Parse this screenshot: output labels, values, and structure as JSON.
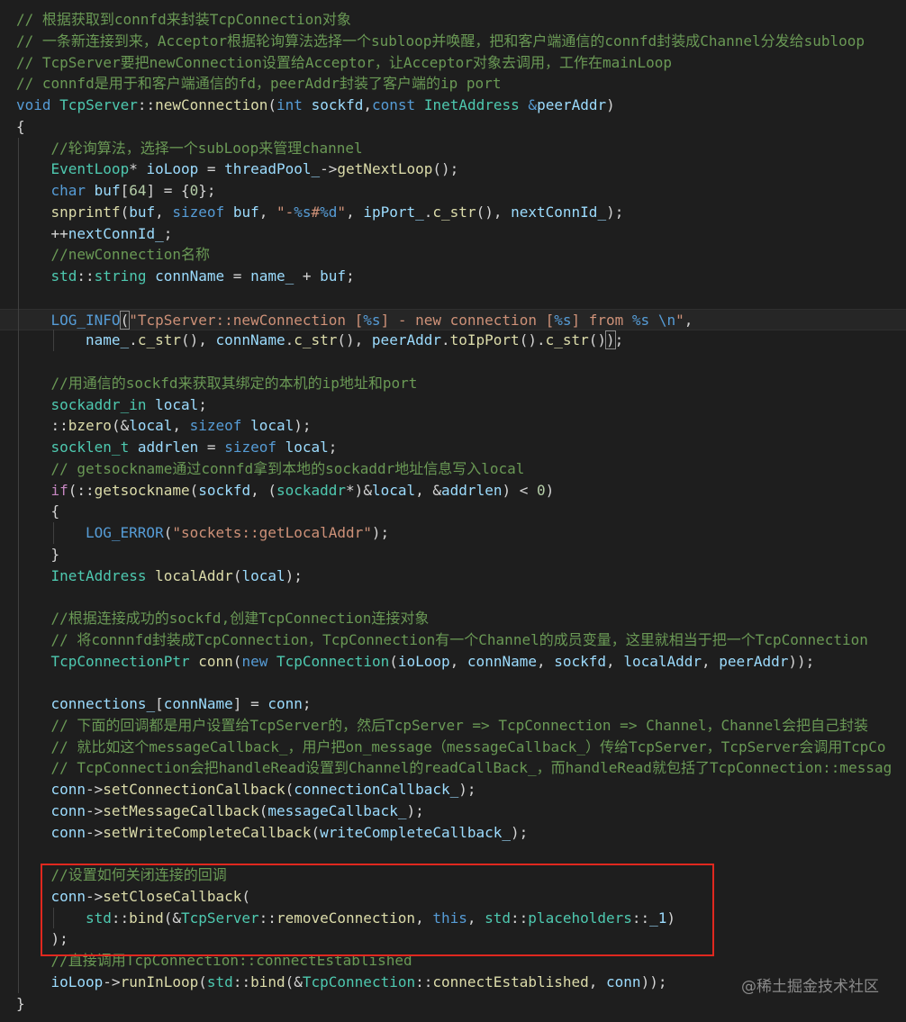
{
  "colors": {
    "background": "#1e1e1e",
    "comment": "#6a9955",
    "keyword": "#569cd6",
    "control": "#c586c0",
    "type": "#4ec9b0",
    "function": "#dcdcaa",
    "variable": "#9cdcfe",
    "string": "#ce9178",
    "number": "#b5cea8",
    "macro": "#569cd6",
    "plain": "#d4d4d4",
    "highlight_border": "#e0281f"
  },
  "code": {
    "lines": [
      {
        "indent": 0,
        "tokens": [
          [
            "c",
            "// 根据获取到connfd来封装TcpConnection对象"
          ]
        ]
      },
      {
        "indent": 0,
        "tokens": [
          [
            "c",
            "// 一条新连接到来，Acceptor根据轮询算法选择一个subloop并唤醒，把和客户端通信的connfd封装成Channel分发给subloop"
          ]
        ]
      },
      {
        "indent": 0,
        "tokens": [
          [
            "c",
            "// TcpServer要把newConnection设置给Acceptor，让Acceptor对象去调用，工作在mainLoop"
          ]
        ]
      },
      {
        "indent": 0,
        "tokens": [
          [
            "c",
            "// connfd是用于和客户端通信的fd，peerAddr封装了客户端的ip port"
          ]
        ]
      },
      {
        "indent": 0,
        "tokens": [
          [
            "k",
            "void"
          ],
          [
            "p",
            " "
          ],
          [
            "t",
            "TcpServer"
          ],
          [
            "p",
            "::"
          ],
          [
            "f",
            "newConnection"
          ],
          [
            "p",
            "("
          ],
          [
            "k",
            "int"
          ],
          [
            "p",
            " "
          ],
          [
            "v",
            "sockfd"
          ],
          [
            "p",
            ","
          ],
          [
            "k",
            "const"
          ],
          [
            "p",
            " "
          ],
          [
            "t",
            "InetAddress"
          ],
          [
            "p",
            " "
          ],
          [
            "k",
            "&"
          ],
          [
            "v",
            "peerAddr"
          ],
          [
            "p",
            ")"
          ]
        ]
      },
      {
        "indent": 0,
        "tokens": [
          [
            "p",
            "{"
          ]
        ]
      },
      {
        "indent": 1,
        "tokens": [
          [
            "c",
            "//轮询算法，选择一个subLoop来管理channel"
          ]
        ]
      },
      {
        "indent": 1,
        "tokens": [
          [
            "t",
            "EventLoop"
          ],
          [
            "p",
            "* "
          ],
          [
            "v",
            "ioLoop"
          ],
          [
            "p",
            " = "
          ],
          [
            "v",
            "threadPool_"
          ],
          [
            "p",
            "->"
          ],
          [
            "f",
            "getNextLoop"
          ],
          [
            "p",
            "();"
          ]
        ]
      },
      {
        "indent": 1,
        "tokens": [
          [
            "k",
            "char"
          ],
          [
            "p",
            " "
          ],
          [
            "v",
            "buf"
          ],
          [
            "p",
            "["
          ],
          [
            "n",
            "64"
          ],
          [
            "p",
            "] = {"
          ],
          [
            "n",
            "0"
          ],
          [
            "p",
            "};"
          ]
        ]
      },
      {
        "indent": 1,
        "tokens": [
          [
            "f",
            "snprintf"
          ],
          [
            "p",
            "("
          ],
          [
            "v",
            "buf"
          ],
          [
            "p",
            ", "
          ],
          [
            "k",
            "sizeof"
          ],
          [
            "p",
            " "
          ],
          [
            "v",
            "buf"
          ],
          [
            "p",
            ", "
          ],
          [
            "s",
            "\"-"
          ],
          [
            "k",
            "%s"
          ],
          [
            "s",
            "#"
          ],
          [
            "k",
            "%d"
          ],
          [
            "s",
            "\""
          ],
          [
            "p",
            ", "
          ],
          [
            "v",
            "ipPort_"
          ],
          [
            "p",
            "."
          ],
          [
            "f",
            "c_str"
          ],
          [
            "p",
            "(), "
          ],
          [
            "v",
            "nextConnId_"
          ],
          [
            "p",
            ");"
          ]
        ]
      },
      {
        "indent": 1,
        "tokens": [
          [
            "p",
            "++"
          ],
          [
            "v",
            "nextConnId_"
          ],
          [
            "p",
            ";"
          ]
        ]
      },
      {
        "indent": 1,
        "tokens": [
          [
            "c",
            "//newConnection名称"
          ]
        ]
      },
      {
        "indent": 1,
        "tokens": [
          [
            "t",
            "std"
          ],
          [
            "p",
            "::"
          ],
          [
            "t",
            "string"
          ],
          [
            "p",
            " "
          ],
          [
            "v",
            "connName"
          ],
          [
            "p",
            " = "
          ],
          [
            "v",
            "name_"
          ],
          [
            "p",
            " + "
          ],
          [
            "v",
            "buf"
          ],
          [
            "p",
            ";"
          ]
        ]
      },
      {
        "indent": 1,
        "tokens": []
      },
      {
        "indent": 1,
        "current": true,
        "tokens": [
          [
            "m",
            "LOG_INFO"
          ],
          [
            "b",
            "("
          ],
          [
            "s",
            "\"TcpServer::newConnection ["
          ],
          [
            "k",
            "%s"
          ],
          [
            "s",
            "] - new connection ["
          ],
          [
            "k",
            "%s"
          ],
          [
            "s",
            "] from "
          ],
          [
            "k",
            "%s"
          ],
          [
            "s",
            " "
          ],
          [
            "k",
            "\\n"
          ],
          [
            "s",
            "\""
          ],
          [
            "p",
            ","
          ]
        ]
      },
      {
        "indent": 2,
        "tokens": [
          [
            "v",
            "name_"
          ],
          [
            "p",
            "."
          ],
          [
            "f",
            "c_str"
          ],
          [
            "p",
            "(), "
          ],
          [
            "v",
            "connName"
          ],
          [
            "p",
            "."
          ],
          [
            "f",
            "c_str"
          ],
          [
            "p",
            "(), "
          ],
          [
            "v",
            "peerAddr"
          ],
          [
            "p",
            "."
          ],
          [
            "f",
            "toIpPort"
          ],
          [
            "p",
            "()."
          ],
          [
            "f",
            "c_str"
          ],
          [
            "p",
            "()"
          ],
          [
            "b",
            ")"
          ],
          [
            "p",
            ";"
          ]
        ]
      },
      {
        "indent": 1,
        "tokens": []
      },
      {
        "indent": 1,
        "tokens": [
          [
            "c",
            "//用通信的sockfd来获取其绑定的本机的ip地址和port"
          ]
        ]
      },
      {
        "indent": 1,
        "tokens": [
          [
            "t",
            "sockaddr_in"
          ],
          [
            "p",
            " "
          ],
          [
            "v",
            "local"
          ],
          [
            "p",
            ";"
          ]
        ]
      },
      {
        "indent": 1,
        "tokens": [
          [
            "p",
            "::"
          ],
          [
            "f",
            "bzero"
          ],
          [
            "p",
            "(&"
          ],
          [
            "v",
            "local"
          ],
          [
            "p",
            ", "
          ],
          [
            "k",
            "sizeof"
          ],
          [
            "p",
            " "
          ],
          [
            "v",
            "local"
          ],
          [
            "p",
            ");"
          ]
        ]
      },
      {
        "indent": 1,
        "tokens": [
          [
            "t",
            "socklen_t"
          ],
          [
            "p",
            " "
          ],
          [
            "v",
            "addrlen"
          ],
          [
            "p",
            " = "
          ],
          [
            "k",
            "sizeof"
          ],
          [
            "p",
            " "
          ],
          [
            "v",
            "local"
          ],
          [
            "p",
            ";"
          ]
        ]
      },
      {
        "indent": 1,
        "tokens": [
          [
            "c",
            "// getsockname通过connfd拿到本地的sockaddr地址信息写入local"
          ]
        ]
      },
      {
        "indent": 1,
        "tokens": [
          [
            "x",
            "if"
          ],
          [
            "p",
            "(::"
          ],
          [
            "f",
            "getsockname"
          ],
          [
            "p",
            "("
          ],
          [
            "v",
            "sockfd"
          ],
          [
            "p",
            ", ("
          ],
          [
            "t",
            "sockaddr"
          ],
          [
            "p",
            "*)&"
          ],
          [
            "v",
            "local"
          ],
          [
            "p",
            ", &"
          ],
          [
            "v",
            "addrlen"
          ],
          [
            "p",
            ") < "
          ],
          [
            "n",
            "0"
          ],
          [
            "p",
            ")"
          ]
        ]
      },
      {
        "indent": 1,
        "tokens": [
          [
            "p",
            "{"
          ]
        ]
      },
      {
        "indent": 2,
        "tokens": [
          [
            "m",
            "LOG_ERROR"
          ],
          [
            "p",
            "("
          ],
          [
            "s",
            "\"sockets::getLocalAddr\""
          ],
          [
            "p",
            ");"
          ]
        ]
      },
      {
        "indent": 1,
        "tokens": [
          [
            "p",
            "}"
          ]
        ]
      },
      {
        "indent": 1,
        "tokens": [
          [
            "t",
            "InetAddress"
          ],
          [
            "p",
            " "
          ],
          [
            "f",
            "localAddr"
          ],
          [
            "p",
            "("
          ],
          [
            "v",
            "local"
          ],
          [
            "p",
            ");"
          ]
        ]
      },
      {
        "indent": 1,
        "tokens": []
      },
      {
        "indent": 1,
        "tokens": [
          [
            "c",
            "//根据连接成功的sockfd,创建TcpConnection连接对象"
          ]
        ]
      },
      {
        "indent": 1,
        "tokens": [
          [
            "c",
            "// 将connnfd封装成TcpConnection，TcpConnection有一个Channel的成员变量，这里就相当于把一个TcpConnection"
          ]
        ]
      },
      {
        "indent": 1,
        "tokens": [
          [
            "t",
            "TcpConnectionPtr"
          ],
          [
            "p",
            " "
          ],
          [
            "f",
            "conn"
          ],
          [
            "p",
            "("
          ],
          [
            "k",
            "new"
          ],
          [
            "p",
            " "
          ],
          [
            "t",
            "TcpConnection"
          ],
          [
            "p",
            "("
          ],
          [
            "v",
            "ioLoop"
          ],
          [
            "p",
            ", "
          ],
          [
            "v",
            "connName"
          ],
          [
            "p",
            ", "
          ],
          [
            "v",
            "sockfd"
          ],
          [
            "p",
            ", "
          ],
          [
            "v",
            "localAddr"
          ],
          [
            "p",
            ", "
          ],
          [
            "v",
            "peerAddr"
          ],
          [
            "p",
            "));"
          ]
        ]
      },
      {
        "indent": 1,
        "tokens": []
      },
      {
        "indent": 1,
        "tokens": [
          [
            "v",
            "connections_"
          ],
          [
            "p",
            "["
          ],
          [
            "v",
            "connName"
          ],
          [
            "p",
            "] = "
          ],
          [
            "v",
            "conn"
          ],
          [
            "p",
            ";"
          ]
        ]
      },
      {
        "indent": 1,
        "tokens": [
          [
            "c",
            "// 下面的回调都是用户设置给TcpServer的，然后TcpServer => TcpConnection => Channel，Channel会把自己封装"
          ]
        ]
      },
      {
        "indent": 1,
        "tokens": [
          [
            "c",
            "// 就比如这个messageCallback_，用户把on_message（messageCallback_）传给TcpServer，TcpServer会调用TcpCo"
          ]
        ]
      },
      {
        "indent": 1,
        "tokens": [
          [
            "c",
            "// TcpConnection会把handleRead设置到Channel的readCallBack_，而handleRead就包括了TcpConnection::messag"
          ]
        ]
      },
      {
        "indent": 1,
        "tokens": [
          [
            "v",
            "conn"
          ],
          [
            "p",
            "->"
          ],
          [
            "f",
            "setConnectionCallback"
          ],
          [
            "p",
            "("
          ],
          [
            "v",
            "connectionCallback_"
          ],
          [
            "p",
            ");"
          ]
        ]
      },
      {
        "indent": 1,
        "tokens": [
          [
            "v",
            "conn"
          ],
          [
            "p",
            "->"
          ],
          [
            "f",
            "setMessageCallback"
          ],
          [
            "p",
            "("
          ],
          [
            "v",
            "messageCallback_"
          ],
          [
            "p",
            ");"
          ]
        ]
      },
      {
        "indent": 1,
        "tokens": [
          [
            "v",
            "conn"
          ],
          [
            "p",
            "->"
          ],
          [
            "f",
            "setWriteCompleteCallback"
          ],
          [
            "p",
            "("
          ],
          [
            "v",
            "writeCompleteCallback_"
          ],
          [
            "p",
            ");"
          ]
        ]
      },
      {
        "indent": 1,
        "tokens": []
      },
      {
        "indent": 1,
        "tokens": [
          [
            "c",
            "//设置如何关闭连接的回调"
          ]
        ]
      },
      {
        "indent": 1,
        "tokens": [
          [
            "v",
            "conn"
          ],
          [
            "p",
            "->"
          ],
          [
            "f",
            "setCloseCallback"
          ],
          [
            "p",
            "("
          ]
        ]
      },
      {
        "indent": 2,
        "tokens": [
          [
            "t",
            "std"
          ],
          [
            "p",
            "::"
          ],
          [
            "f",
            "bind"
          ],
          [
            "p",
            "(&"
          ],
          [
            "t",
            "TcpServer"
          ],
          [
            "p",
            "::"
          ],
          [
            "f",
            "removeConnection"
          ],
          [
            "p",
            ", "
          ],
          [
            "k",
            "this"
          ],
          [
            "p",
            ", "
          ],
          [
            "t",
            "std"
          ],
          [
            "p",
            "::"
          ],
          [
            "t",
            "placeholders"
          ],
          [
            "p",
            "::"
          ],
          [
            "v",
            "_1"
          ],
          [
            "p",
            ")"
          ]
        ]
      },
      {
        "indent": 1,
        "tokens": [
          [
            "p",
            ");"
          ]
        ]
      },
      {
        "indent": 1,
        "tokens": [
          [
            "c",
            "//直接调用TcpConnection::connectEstablished"
          ]
        ]
      },
      {
        "indent": 1,
        "tokens": [
          [
            "v",
            "ioLoop"
          ],
          [
            "p",
            "->"
          ],
          [
            "f",
            "runInLoop"
          ],
          [
            "p",
            "("
          ],
          [
            "t",
            "std"
          ],
          [
            "p",
            "::"
          ],
          [
            "f",
            "bind"
          ],
          [
            "p",
            "(&"
          ],
          [
            "t",
            "TcpConnection"
          ],
          [
            "p",
            "::"
          ],
          [
            "f",
            "connectEstablished"
          ],
          [
            "p",
            ", "
          ],
          [
            "v",
            "conn"
          ],
          [
            "p",
            "));"
          ]
        ]
      },
      {
        "indent": 0,
        "tokens": [
          [
            "p",
            "}"
          ]
        ]
      }
    ]
  },
  "watermark": {
    "text": "@稀土掘金技术社区"
  }
}
